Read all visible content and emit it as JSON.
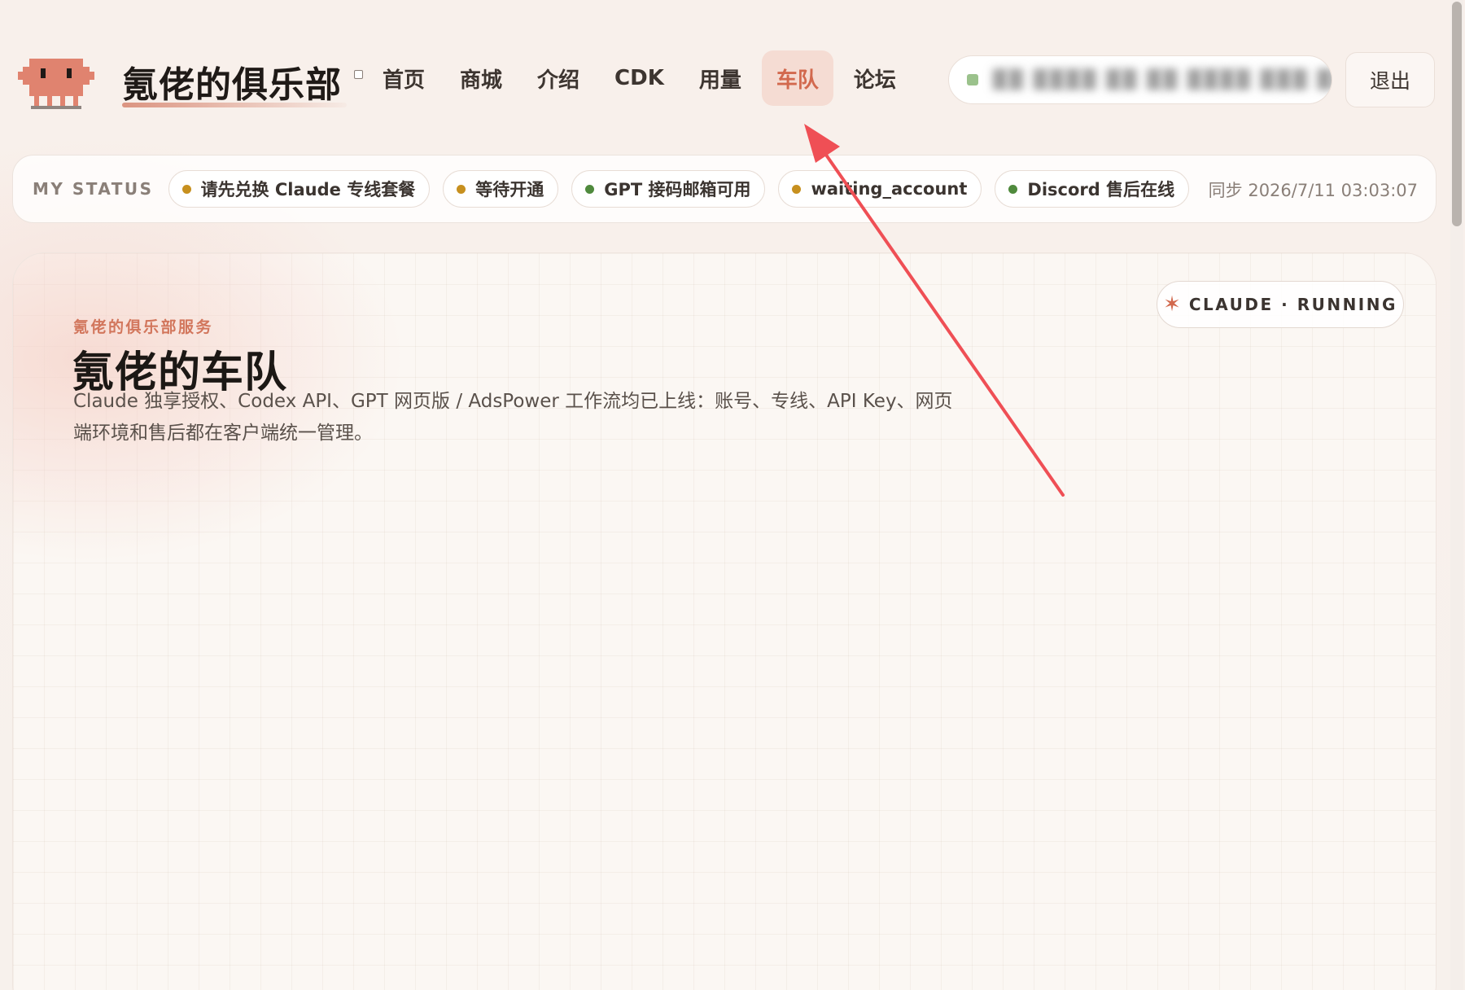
{
  "header": {
    "brand": "氪佬的俱乐部",
    "nav": [
      {
        "label": "首页",
        "active": false
      },
      {
        "label": "商城",
        "active": false
      },
      {
        "label": "介绍",
        "active": false
      },
      {
        "label": "CDK",
        "active": false
      },
      {
        "label": "用量",
        "active": false
      },
      {
        "label": "车队",
        "active": true
      },
      {
        "label": "论坛",
        "active": false
      }
    ],
    "user": {
      "name": "██ ████ ██ ██ ████ ███ ██",
      "status_color": "#9bc28c"
    },
    "logout_label": "退出"
  },
  "status": {
    "label": "MY STATUS",
    "chips": [
      {
        "label": "请先兑换 Claude 专线套餐",
        "dot_color": "#c7901f"
      },
      {
        "label": "等待开通",
        "dot_color": "#c7901f"
      },
      {
        "label": "GPT 接码邮箱可用",
        "dot_color": "#4f8a3d"
      },
      {
        "label": "waiting_account",
        "dot_color": "#c7901f"
      },
      {
        "label": "Discord 售后在线",
        "dot_color": "#4f8a3d"
      }
    ],
    "sync": "同步 2026/7/11 03:03:07"
  },
  "main": {
    "eyebrow": "氪佬的俱乐部服务",
    "title": "氪佬的车队",
    "description": "Claude 独享授权、Codex API、GPT 网页版 / AdsPower 工作流均已上线：账号、专线、API Key、网页端环境和售后都在客户端统一管理。",
    "badge": {
      "icon": "star-icon",
      "label": "CLAUDE · RUNNING"
    }
  },
  "colors": {
    "accent": "#d2694e",
    "nav_active_bg": "#f5dcd3",
    "annotation_arrow": "#ef4f55"
  }
}
